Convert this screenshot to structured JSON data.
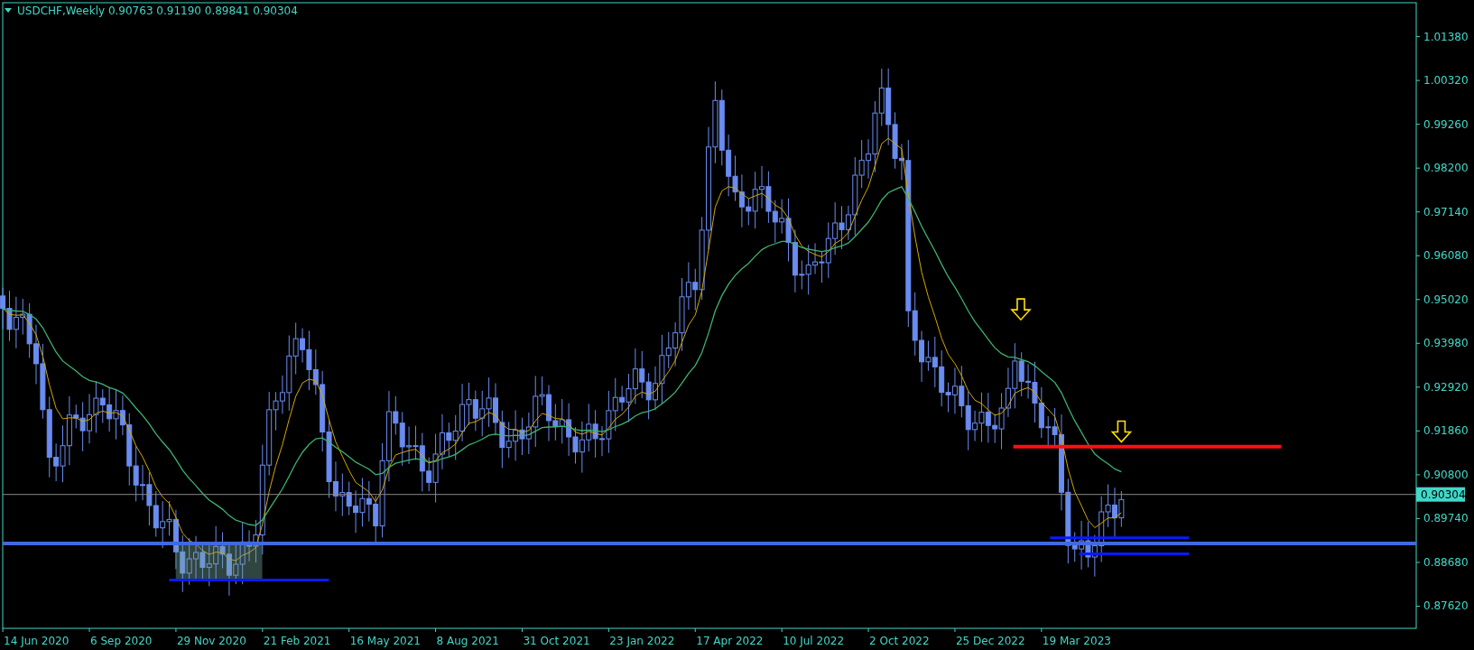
{
  "chart": {
    "title": "USDCHF,Weekly",
    "ohlc": [
      "0.90763",
      "0.91190",
      "0.89841",
      "0.90304"
    ],
    "price_labels": [
      "1.01380",
      "1.00320",
      "0.99260",
      "0.98200",
      "0.97140",
      "0.96080",
      "0.95020",
      "0.93980",
      "0.92920",
      "0.91860",
      "0.90800",
      "0.89740",
      "0.88680",
      "0.87620"
    ],
    "current_price": "0.90304",
    "date_labels": [
      "14 Jun 2020",
      "6 Sep 2020",
      "29 Nov 2020",
      "21 Feb 2021",
      "16 May 2021",
      "8 Aug 2021",
      "31 Oct 2021",
      "23 Jan 2022",
      "17 Apr 2022",
      "10 Jul 2022",
      "2 Oct 2022",
      "25 Dec 2022",
      "19 Mar 2023"
    ]
  }
}
